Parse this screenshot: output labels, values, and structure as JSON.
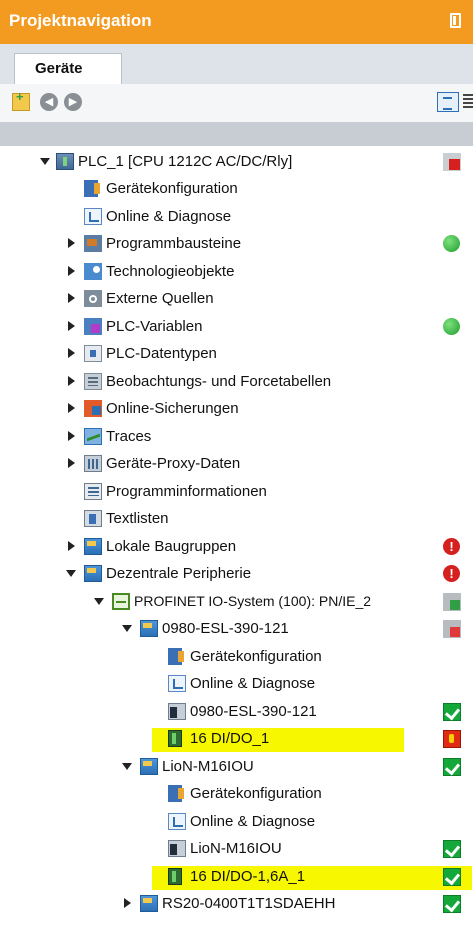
{
  "panel": {
    "title": "Projektnavigation"
  },
  "tabs": [
    {
      "label": "Geräte"
    }
  ],
  "tree": [
    {
      "label": "PLC_1 [CPU 1212C AC/DC/Rly]",
      "icon": "plc-icon",
      "status": "plc-error-icon"
    },
    {
      "label": "Gerätekonfiguration",
      "icon": "device-config-icon",
      "status": ""
    },
    {
      "label": "Online & Diagnose",
      "icon": "online-diagnostics-icon",
      "status": ""
    },
    {
      "label": "Programmbausteine",
      "icon": "program-blocks-icon",
      "status": "green-dot-icon"
    },
    {
      "label": "Technologieobjekte",
      "icon": "technology-objects-icon",
      "status": ""
    },
    {
      "label": "Externe Quellen",
      "icon": "external-sources-icon",
      "status": ""
    },
    {
      "label": "PLC-Variablen",
      "icon": "plc-tags-icon",
      "status": "green-dot-icon"
    },
    {
      "label": "PLC-Datentypen",
      "icon": "plc-datatypes-icon",
      "status": ""
    },
    {
      "label": "Beobachtungs- und Forcetabellen",
      "icon": "watch-tables-icon",
      "status": ""
    },
    {
      "label": "Online-Sicherungen",
      "icon": "online-backups-icon",
      "status": ""
    },
    {
      "label": "Traces",
      "icon": "traces-icon",
      "status": ""
    },
    {
      "label": "Geräte-Proxy-Daten",
      "icon": "device-proxy-icon",
      "status": ""
    },
    {
      "label": "Programminformationen",
      "icon": "program-info-icon",
      "status": ""
    },
    {
      "label": "Textlisten",
      "icon": "text-lists-icon",
      "status": ""
    },
    {
      "label": "Lokale Baugruppen",
      "icon": "local-modules-icon",
      "status": "error-icon"
    },
    {
      "label": "Dezentrale Peripherie",
      "icon": "distributed-io-icon",
      "status": "error-icon"
    },
    {
      "label": "PROFINET IO-System (100): PN/IE_2",
      "icon": "profinet-system-icon",
      "status": "network-warning-icon"
    },
    {
      "label": "0980-ESL-390-121",
      "icon": "io-device-folder-icon",
      "status": "network-warning-icon"
    },
    {
      "label": "Gerätekonfiguration",
      "icon": "device-config-icon",
      "status": ""
    },
    {
      "label": "Online & Diagnose",
      "icon": "online-diagnostics-icon",
      "status": ""
    },
    {
      "label": "0980-ESL-390-121",
      "icon": "io-station-icon",
      "status": "check-icon"
    },
    {
      "label": "16 DI/DO_1",
      "icon": "io-module-icon",
      "status": "wrench-error-icon"
    },
    {
      "label": "LioN-M16IOU",
      "icon": "io-device-folder-icon",
      "status": "check-icon"
    },
    {
      "label": "Gerätekonfiguration",
      "icon": "device-config-icon",
      "status": ""
    },
    {
      "label": "Online & Diagnose",
      "icon": "online-diagnostics-icon",
      "status": ""
    },
    {
      "label": "LioN-M16IOU",
      "icon": "io-station-icon",
      "status": "check-icon"
    },
    {
      "label": "16 DI/DO-1,6A_1",
      "icon": "io-module-icon",
      "status": "check-icon"
    },
    {
      "label": "RS20-0400T1T1SDAEHH",
      "icon": "io-device-folder-icon",
      "status": "check-icon"
    }
  ],
  "colors": {
    "title_bg": "#f39a21",
    "highlight": "#f7f700",
    "ok": "#14a83a",
    "error": "#d6201f"
  }
}
